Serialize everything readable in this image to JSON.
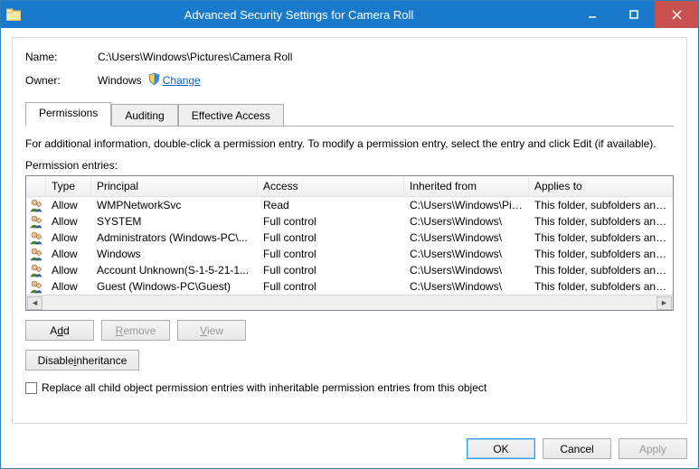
{
  "titlebar": {
    "title": "Advanced Security Settings for Camera Roll"
  },
  "name_label": "Name:",
  "name_value": "C:\\Users\\Windows\\Pictures\\Camera Roll",
  "owner_label": "Owner:",
  "owner_value": "Windows",
  "change_link": "Change",
  "tabs": {
    "permissions": "Permissions",
    "auditing": "Auditing",
    "effective": "Effective Access"
  },
  "info_text": "For additional information, double-click a permission entry. To modify a permission entry, select the entry and click Edit (if available).",
  "perm_entries_label": "Permission entries:",
  "columns": {
    "type": "Type",
    "principal": "Principal",
    "access": "Access",
    "inherited": "Inherited from",
    "applies": "Applies to"
  },
  "rows": [
    {
      "type": "Allow",
      "principal": "WMPNetworkSvc",
      "access": "Read",
      "inherited": "C:\\Users\\Windows\\Pic...",
      "applies": "This folder, subfolders and files"
    },
    {
      "type": "Allow",
      "principal": "SYSTEM",
      "access": "Full control",
      "inherited": "C:\\Users\\Windows\\",
      "applies": "This folder, subfolders and files"
    },
    {
      "type": "Allow",
      "principal": "Administrators (Windows-PC\\...",
      "access": "Full control",
      "inherited": "C:\\Users\\Windows\\",
      "applies": "This folder, subfolders and files"
    },
    {
      "type": "Allow",
      "principal": "Windows",
      "access": "Full control",
      "inherited": "C:\\Users\\Windows\\",
      "applies": "This folder, subfolders and files"
    },
    {
      "type": "Allow",
      "principal": "Account Unknown(S-1-5-21-1...",
      "access": "Full control",
      "inherited": "C:\\Users\\Windows\\",
      "applies": "This folder, subfolders and files"
    },
    {
      "type": "Allow",
      "principal": "Guest (Windows-PC\\Guest)",
      "access": "Full control",
      "inherited": "C:\\Users\\Windows\\",
      "applies": "This folder, subfolders and files"
    }
  ],
  "buttons": {
    "add": "Add",
    "add_u": "d",
    "remove": "Remove",
    "remove_u": "R",
    "view": "View",
    "view_u": "V",
    "disable_inh": "Disable inheritance",
    "disable_inh_u": "i",
    "ok": "OK",
    "cancel": "Cancel",
    "apply": "Apply"
  },
  "checkbox_label": "Replace all child object permission entries with inheritable permission entries from this object"
}
